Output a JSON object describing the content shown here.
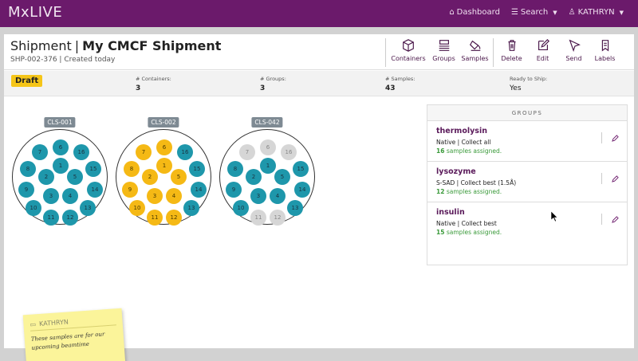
{
  "nav": {
    "brand": "MxLIVE",
    "dashboard": "Dashboard",
    "search": "Search",
    "user": "KATHRYN"
  },
  "header": {
    "title": "Shipment",
    "separator": "|",
    "name": "My CMCF Shipment",
    "subtitle": "SHP-002-376 | Created today"
  },
  "toolbar": {
    "containers": "Containers",
    "groups": "Groups",
    "samples": "Samples",
    "delete": "Delete",
    "edit": "Edit",
    "send": "Send",
    "labels": "Labels"
  },
  "status": {
    "badge": "Draft",
    "containers_label": "# Containers:",
    "containers_value": "3",
    "groups_label": "# Groups:",
    "groups_value": "3",
    "samples_label": "# Samples:",
    "samples_value": "43",
    "ready_label": "Ready to Ship:",
    "ready_value": "Yes"
  },
  "containers": [
    {
      "name": "CLS-001",
      "ports": [
        {
          "n": "1",
          "c": "teal"
        },
        {
          "n": "2",
          "c": "teal"
        },
        {
          "n": "3",
          "c": "teal"
        },
        {
          "n": "4",
          "c": "teal"
        },
        {
          "n": "5",
          "c": "teal"
        },
        {
          "n": "6",
          "c": "teal"
        },
        {
          "n": "7",
          "c": "teal"
        },
        {
          "n": "8",
          "c": "teal"
        },
        {
          "n": "9",
          "c": "teal"
        },
        {
          "n": "10",
          "c": "teal"
        },
        {
          "n": "11",
          "c": "teal"
        },
        {
          "n": "12",
          "c": "teal"
        },
        {
          "n": "13",
          "c": "teal"
        },
        {
          "n": "14",
          "c": "teal"
        },
        {
          "n": "15",
          "c": "teal"
        },
        {
          "n": "16",
          "c": "teal"
        }
      ]
    },
    {
      "name": "CLS-002",
      "ports": [
        {
          "n": "1",
          "c": "yellow"
        },
        {
          "n": "2",
          "c": "yellow"
        },
        {
          "n": "3",
          "c": "yellow"
        },
        {
          "n": "4",
          "c": "yellow"
        },
        {
          "n": "5",
          "c": "yellow"
        },
        {
          "n": "6",
          "c": "yellow"
        },
        {
          "n": "7",
          "c": "yellow"
        },
        {
          "n": "8",
          "c": "yellow"
        },
        {
          "n": "9",
          "c": "yellow"
        },
        {
          "n": "10",
          "c": "yellow"
        },
        {
          "n": "11",
          "c": "yellow"
        },
        {
          "n": "12",
          "c": "yellow"
        },
        {
          "n": "13",
          "c": "teal"
        },
        {
          "n": "14",
          "c": "teal"
        },
        {
          "n": "15",
          "c": "teal"
        },
        {
          "n": "16",
          "c": "teal"
        }
      ]
    },
    {
      "name": "CLS-042",
      "ports": [
        {
          "n": "1",
          "c": "teal"
        },
        {
          "n": "2",
          "c": "teal"
        },
        {
          "n": "3",
          "c": "teal"
        },
        {
          "n": "4",
          "c": "teal"
        },
        {
          "n": "5",
          "c": "teal"
        },
        {
          "n": "6",
          "c": "grey"
        },
        {
          "n": "7",
          "c": "grey"
        },
        {
          "n": "8",
          "c": "teal"
        },
        {
          "n": "9",
          "c": "teal"
        },
        {
          "n": "10",
          "c": "teal"
        },
        {
          "n": "11",
          "c": "grey"
        },
        {
          "n": "12",
          "c": "grey"
        },
        {
          "n": "13",
          "c": "teal"
        },
        {
          "n": "14",
          "c": "teal"
        },
        {
          "n": "15",
          "c": "teal"
        },
        {
          "n": "16",
          "c": "grey"
        }
      ]
    }
  ],
  "groups": {
    "heading": "GROUPS",
    "items": [
      {
        "name": "thermolysin",
        "desc": "Native | Collect all",
        "count": "16",
        "count_suffix": "samples assigned."
      },
      {
        "name": "lysozyme",
        "desc": "S-SAD | Collect best (1.5Å)",
        "count": "12",
        "count_suffix": "samples assigned."
      },
      {
        "name": "insulin",
        "desc": "Native | Collect best",
        "count": "15",
        "count_suffix": "samples assigned."
      }
    ]
  },
  "note": {
    "author": "KATHRYN",
    "text": "These samples are for our upcoming beamtime"
  },
  "colors": {
    "nav": "#6b1a6b",
    "teal": "#1e97ab",
    "yellow": "#f5b915",
    "grey": "#d6d6d6",
    "badge": "#f5c518"
  }
}
